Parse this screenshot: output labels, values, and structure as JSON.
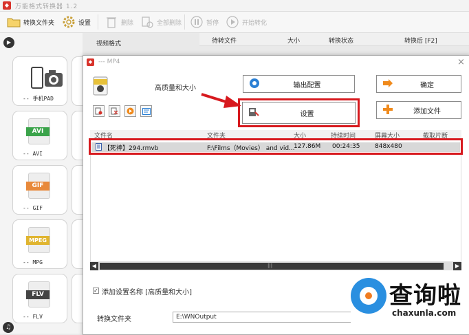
{
  "app": {
    "title": "万能格式转换器 1.2"
  },
  "toolbar": {
    "convert_folder": "转换文件夹",
    "settings": "设置",
    "delete": "删除",
    "delete_all": "全部删除",
    "pause": "暂停",
    "start": "开始转化"
  },
  "left_panel": {
    "video_format_label": "视频格式",
    "cards": [
      {
        "label": "-- 手机PAD",
        "icon": "phone-camera-icon"
      },
      {
        "label": "-- AVI",
        "band": "AVI",
        "color": "#3aa34a"
      },
      {
        "label": "-- GIF",
        "band": "GIF",
        "color": "#e8893a"
      },
      {
        "label": "-- MPG",
        "band": "MPEG",
        "color": "#e0b530"
      },
      {
        "label": "-- FLV",
        "band": "FLV",
        "color": "#444444"
      }
    ]
  },
  "main_header": {
    "col_file": "待转文件",
    "col_size": "大小",
    "col_status": "转换状态",
    "col_convert_to": "转换后 [F2]"
  },
  "dialog": {
    "title": "--- MP4",
    "quality_label": "高质量和大小",
    "output_config_btn": "输出配置",
    "ok_btn": "确定",
    "settings_btn": "设置",
    "add_file_btn": "添加文件",
    "table": {
      "columns": [
        "文件名",
        "文件夹",
        "大小",
        "持续时间",
        "屏幕大小",
        "截取片断"
      ],
      "rows": [
        {
          "name": "【死神】294.rmvb",
          "folder": "F:\\Films（Movies） and vid...",
          "size": "127.86M",
          "duration": "00:24:35",
          "screen": "848x480"
        }
      ]
    },
    "add_setting_name": "添加设置名称 [高质量和大小]",
    "output_folder_label": "转换文件夹",
    "output_folder_value": "E:\\WNOutput"
  },
  "watermark": {
    "text": "查询啦",
    "url": "chaxunla.com"
  },
  "colors": {
    "highlight_red": "#d7191e",
    "accent_orange": "#f07c21"
  }
}
